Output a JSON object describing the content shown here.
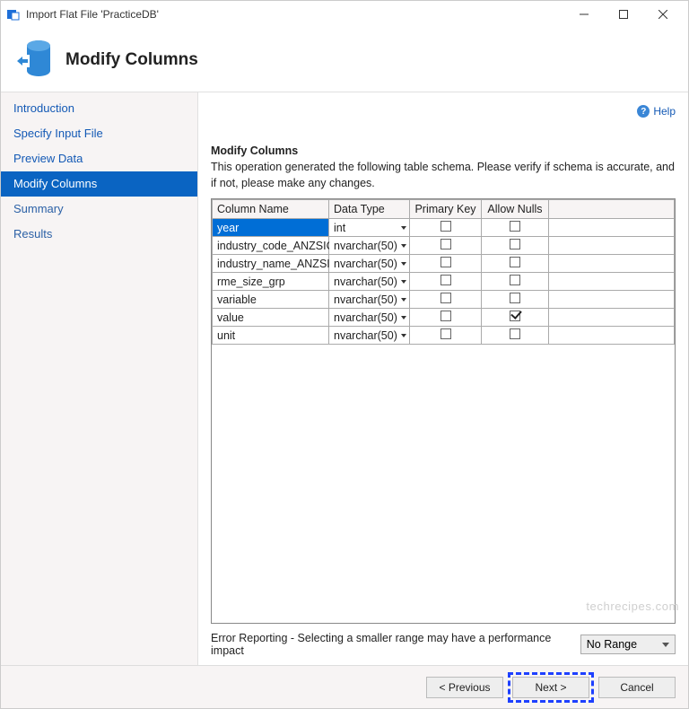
{
  "window": {
    "title": "Import Flat File 'PracticeDB'"
  },
  "header": {
    "page_title": "Modify Columns"
  },
  "help": {
    "label": "Help"
  },
  "sidebar": {
    "items": [
      {
        "label": "Introduction",
        "selected": false
      },
      {
        "label": "Specify Input File",
        "selected": false
      },
      {
        "label": "Preview Data",
        "selected": false
      },
      {
        "label": "Modify Columns",
        "selected": true
      },
      {
        "label": "Summary",
        "selected": false
      },
      {
        "label": "Results",
        "selected": false
      }
    ]
  },
  "main": {
    "section_title": "Modify Columns",
    "section_desc": "This operation generated the following table schema. Please verify if schema is accurate, and if not, please make any changes.",
    "columns": {
      "name": "Column Name",
      "datatype": "Data Type",
      "pk": "Primary Key",
      "nulls": "Allow Nulls"
    },
    "rows": [
      {
        "name": "year",
        "datatype": "int",
        "pk": false,
        "nulls": false,
        "selected": true
      },
      {
        "name": "industry_code_ANZSIC",
        "datatype": "nvarchar(50)",
        "pk": false,
        "nulls": false,
        "selected": false
      },
      {
        "name": "industry_name_ANZSIC",
        "datatype": "nvarchar(50)",
        "pk": false,
        "nulls": false,
        "selected": false
      },
      {
        "name": "rme_size_grp",
        "datatype": "nvarchar(50)",
        "pk": false,
        "nulls": false,
        "selected": false
      },
      {
        "name": "variable",
        "datatype": "nvarchar(50)",
        "pk": false,
        "nulls": false,
        "selected": false
      },
      {
        "name": "value",
        "datatype": "nvarchar(50)",
        "pk": false,
        "nulls": true,
        "selected": false
      },
      {
        "name": "unit",
        "datatype": "nvarchar(50)",
        "pk": false,
        "nulls": false,
        "selected": false
      }
    ],
    "error_label": "Error Reporting - Selecting a smaller range may have a performance impact",
    "range_selected": "No Range"
  },
  "footer": {
    "previous": "< Previous",
    "next": "Next >",
    "cancel": "Cancel"
  },
  "watermark": "techrecipes.com"
}
